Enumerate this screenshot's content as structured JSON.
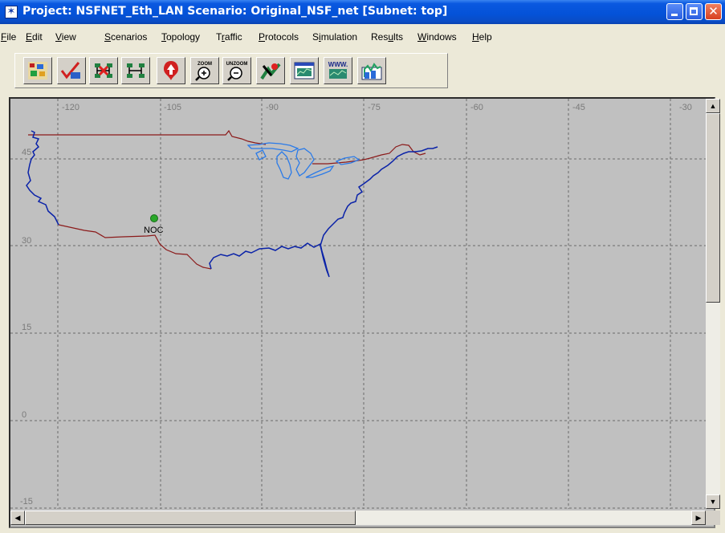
{
  "window": {
    "title": "Project: NSFNET_Eth_LAN Scenario: Original_NSF_net  [Subnet: top]",
    "icon": "opnet-app-icon",
    "controls": [
      "minimize",
      "maximize",
      "close"
    ]
  },
  "menu": [
    {
      "label": "File",
      "underline": "F",
      "rest": "ile"
    },
    {
      "label": "Edit",
      "underline": "E",
      "rest": "dit"
    },
    {
      "label": "View",
      "underline": "V",
      "rest": "iew"
    },
    {
      "label": "Scenarios",
      "underline": "S",
      "rest": "cenarios"
    },
    {
      "label": "Topology",
      "underline": "T",
      "rest": "opology"
    },
    {
      "label": "Traffic",
      "pre": "T",
      "underline": "r",
      "rest": "affic"
    },
    {
      "label": "Protocols",
      "underline": "P",
      "rest": "rotocols"
    },
    {
      "label": "Simulation",
      "pre": "S",
      "underline": "i",
      "rest": "mulation"
    },
    {
      "label": "Results",
      "pre": "Res",
      "underline": "u",
      "rest": "lts"
    },
    {
      "label": "Windows",
      "underline": "W",
      "rest": "indows"
    },
    {
      "label": "Help",
      "underline": "H",
      "rest": "elp"
    }
  ],
  "toolbar": [
    {
      "icon": "object-palette-icon"
    },
    {
      "icon": "check-link-consistency-icon"
    },
    {
      "icon": "fail-node-link-icon"
    },
    {
      "icon": "recover-node-link-icon"
    },
    {
      "icon": "go-to-parent-subnet-icon"
    },
    {
      "icon": "zoom-icon",
      "text": "ZOOM"
    },
    {
      "icon": "unzoom-icon",
      "text": "UNZOOM"
    },
    {
      "icon": "configure-simulation-icon"
    },
    {
      "icon": "view-results-icon"
    },
    {
      "icon": "web-report-icon",
      "text": "WWW."
    },
    {
      "icon": "hide-show-graphs-icon"
    }
  ],
  "map": {
    "longitude_labels": [
      "-120",
      "-105",
      "-90",
      "-75",
      "-60",
      "-45",
      "-30"
    ],
    "latitude_labels": [
      "45",
      "30",
      "15",
      "0",
      "-15"
    ],
    "background_color": "#c0c0c0",
    "border_color": "#8b1a1a",
    "coast_color": "#0a22a8",
    "lakes_color": "#2a7ae8",
    "nodes": [
      {
        "label": "NOC",
        "color": "#2aa82a"
      }
    ]
  },
  "scrollbars": {
    "vertical": "up/down",
    "horizontal": "left/right"
  }
}
